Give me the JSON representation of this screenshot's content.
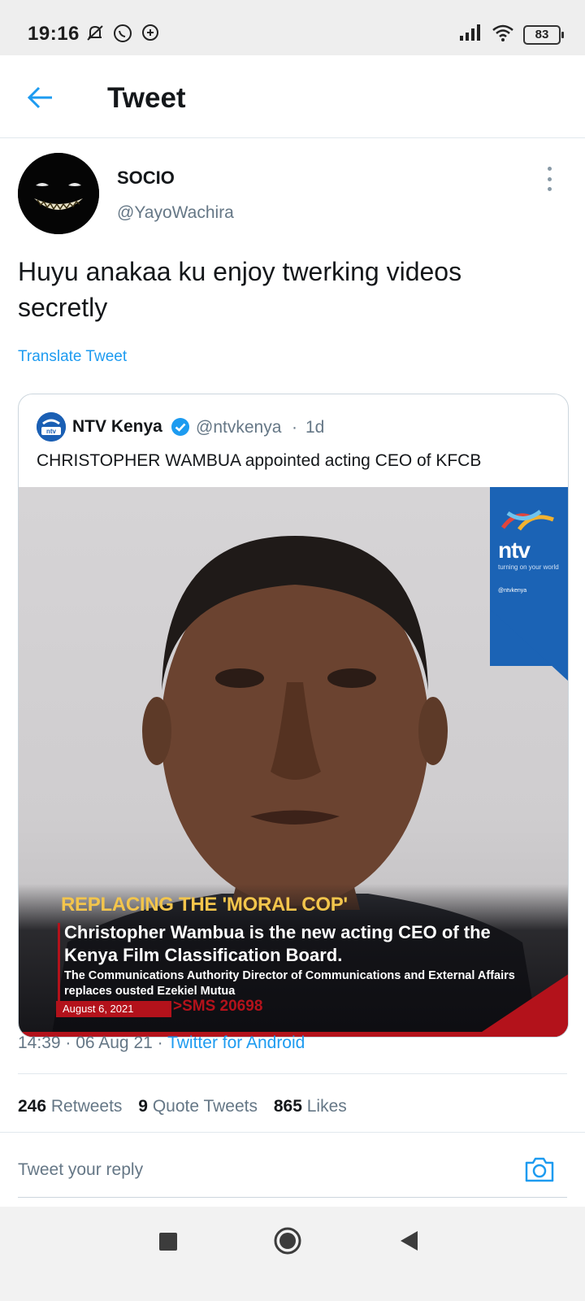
{
  "status_bar": {
    "time": "19:16",
    "battery": "83"
  },
  "header": {
    "title": "Tweet"
  },
  "tweet": {
    "author_name": "SOCIO",
    "author_handle": "@YayoWachira",
    "text": "Huyu anakaa ku enjoy twerking videos secretly",
    "translate_label": "Translate Tweet",
    "timestamp": "14:39 · 06 Aug 21 · ",
    "source": "Twitter for Android"
  },
  "quoted_tweet": {
    "author_name": "NTV Kenya",
    "author_handle": "@ntvkenya",
    "separator": "·",
    "time_ago": "1d",
    "text": "CHRISTOPHER WAMBUA appointed acting CEO of KFCB",
    "image": {
      "brand": "ntv",
      "brand_tagline": "turning on your world",
      "brand_social": "@ntvkenya",
      "kicker": "REPLACING THE 'MORAL COP'",
      "headline": "Christopher Wambua is the new acting CEO of the Kenya Film Classification Board.",
      "subtext": "The Communications Authority Director of Communications and External Affairs replaces ousted Ezekiel Mutua",
      "date": "August 6, 2021",
      "sms": ">SMS 20698"
    }
  },
  "stats": {
    "retweets_count": "246",
    "retweets_label": "Retweets",
    "quotes_count": "9",
    "quotes_label": "Quote Tweets",
    "likes_count": "865",
    "likes_label": "Likes"
  },
  "reply": {
    "placeholder": "Tweet your reply"
  },
  "colors": {
    "accent": "#1d9bf0",
    "ntv_blue": "#1b63b5",
    "ntv_red": "#b3121b",
    "kicker_yellow": "#f3c54c"
  },
  "icons": {
    "back": "arrow-left-icon",
    "more": "more-vertical-icon",
    "verified": "verified-badge-icon",
    "camera": "camera-icon",
    "nav_recents": "square-icon",
    "nav_home": "circle-icon",
    "nav_back": "triangle-back-icon"
  }
}
